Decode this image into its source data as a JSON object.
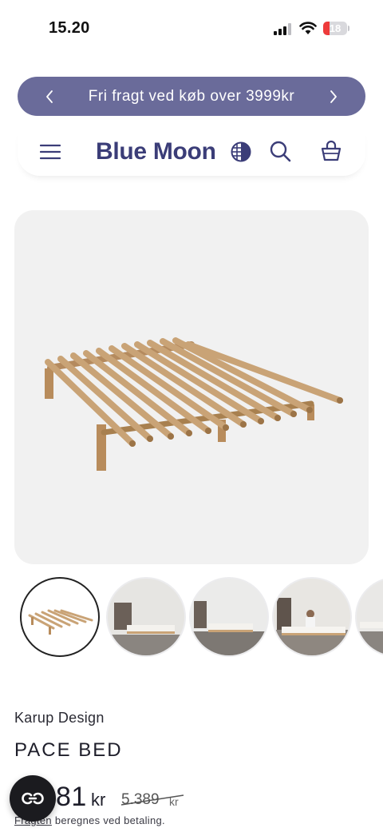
{
  "status_bar": {
    "time": "15.20",
    "battery": "18"
  },
  "promo": {
    "text": "Fri fragt ved køb over 3999kr",
    "prev_icon": "chevron-left-icon",
    "next_icon": "chevron-right-icon"
  },
  "header": {
    "brand": "Blue Moon",
    "icons": [
      "menu-icon",
      "globe-icon",
      "search-icon",
      "bag-icon"
    ]
  },
  "product": {
    "brand": "Karup Design",
    "title": "PACE BED",
    "price_now": "81",
    "price_now_unit": "kr",
    "price_old": "5.389",
    "price_old_unit": "kr"
  },
  "shipping": {
    "link": "Fragten",
    "text": " beregnes ved betaling."
  },
  "colors": {
    "accent": "#6a6b9a",
    "brand": "#3b3d78"
  }
}
